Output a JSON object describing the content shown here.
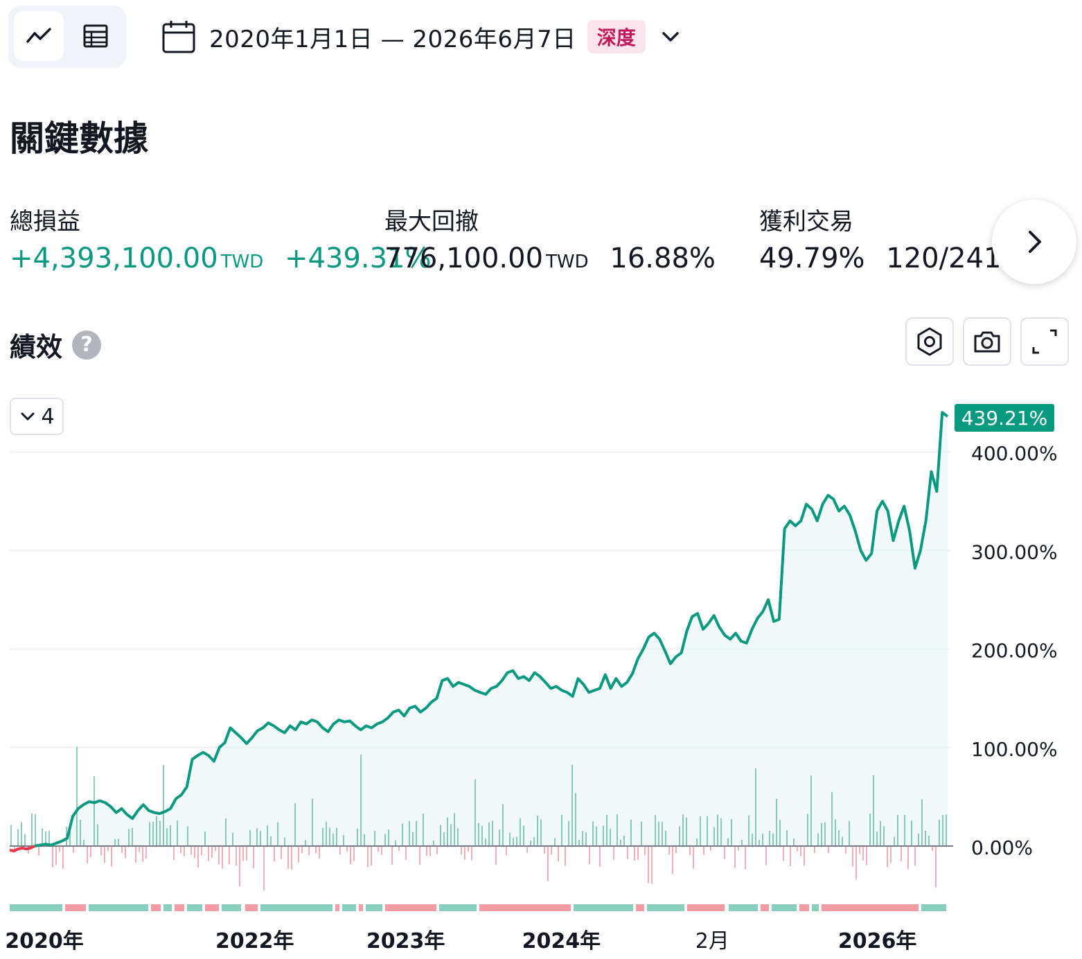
{
  "toolbar": {
    "date_range": "2020年1月1日 — 2026年6月7日",
    "depth_badge": "深度"
  },
  "section_title": "關鍵數據",
  "stats": {
    "net_profit": {
      "label": "總損益",
      "value": "+4,393,100.00",
      "unit": "TWD",
      "percent": "+439.31%"
    },
    "max_drawdown": {
      "label": "最大回撤",
      "value": "776,100.00",
      "unit": "TWD",
      "percent": "16.88%"
    },
    "profitable_trades": {
      "label": "獲利交易",
      "percent": "49.79%",
      "ratio": "120/241"
    }
  },
  "performance": {
    "title": "績效",
    "help": "?",
    "collapse_count": "4"
  },
  "colors": {
    "accent": "#089981",
    "loss": "#f23645",
    "badge_bg": "#fce4ec",
    "badge_text": "#c2185b"
  },
  "chart_data": {
    "type": "area",
    "current_value_label": "439.21%",
    "y_ticks": [
      "400.00%",
      "300.00%",
      "200.00%",
      "100.00%",
      "0.00%"
    ],
    "y_tick_values": [
      400,
      300,
      200,
      100,
      0
    ],
    "ylim": [
      -45,
      450
    ],
    "x_labels": [
      "2020年",
      "2022年",
      "2023年",
      "2024年",
      "2月",
      "2026年"
    ],
    "x_label_fractions": [
      0.047,
      0.27,
      0.43,
      0.595,
      0.755,
      0.93
    ],
    "equity_percent": [
      0,
      1,
      2,
      1,
      3,
      5,
      8,
      30,
      38,
      42,
      45,
      44,
      46,
      44,
      40,
      34,
      38,
      32,
      28,
      36,
      42,
      36,
      34,
      33,
      35,
      38,
      48,
      52,
      60,
      88,
      92,
      95,
      92,
      86,
      100,
      105,
      120,
      115,
      110,
      104,
      110,
      117,
      120,
      125,
      122,
      118,
      115,
      122,
      118,
      126,
      124,
      128,
      126,
      120,
      116,
      124,
      128,
      126,
      127,
      122,
      118,
      122,
      120,
      124,
      126,
      130,
      136,
      138,
      132,
      140,
      142,
      136,
      140,
      146,
      150,
      168,
      170,
      162,
      166,
      164,
      162,
      158,
      156,
      154,
      160,
      162,
      168,
      176,
      178,
      170,
      172,
      168,
      176,
      172,
      166,
      160,
      162,
      158,
      156,
      152,
      170,
      164,
      156,
      158,
      160,
      174,
      160,
      170,
      162,
      166,
      175,
      190,
      200,
      212,
      216,
      210,
      198,
      185,
      192,
      196,
      218,
      233,
      236,
      220,
      226,
      234,
      222,
      214,
      210,
      216,
      208,
      206,
      220,
      231,
      238,
      250,
      228,
      230,
      322,
      330,
      325,
      330,
      347,
      342,
      330,
      347,
      356,
      352,
      340,
      345,
      336,
      320,
      300,
      290,
      297,
      340,
      350,
      340,
      310,
      330,
      345,
      320,
      282,
      300,
      330,
      380,
      360,
      440,
      436
    ],
    "equity_percent_early_loss": [
      -4,
      -5,
      -3,
      -2,
      -3,
      -2,
      0
    ]
  }
}
